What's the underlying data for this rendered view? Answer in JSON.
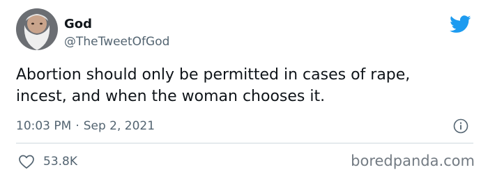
{
  "author": {
    "display_name": "God",
    "handle": "@TheTweetOfGod"
  },
  "tweet": {
    "text": "Abortion should only be permitted in cases of rape,\nincest, and when the woman chooses it.",
    "time": "10:03 PM",
    "separator": "·",
    "date": "Sep 2, 2021"
  },
  "engagement": {
    "likes": "53.8K"
  },
  "watermark": "boredpanda.com",
  "icons": {
    "brand": "twitter-bird-icon",
    "info": "info-icon",
    "like": "heart-icon"
  },
  "colors": {
    "twitter_blue": "#1d9bf0",
    "text_primary": "#0f1419",
    "text_secondary": "#536471"
  }
}
